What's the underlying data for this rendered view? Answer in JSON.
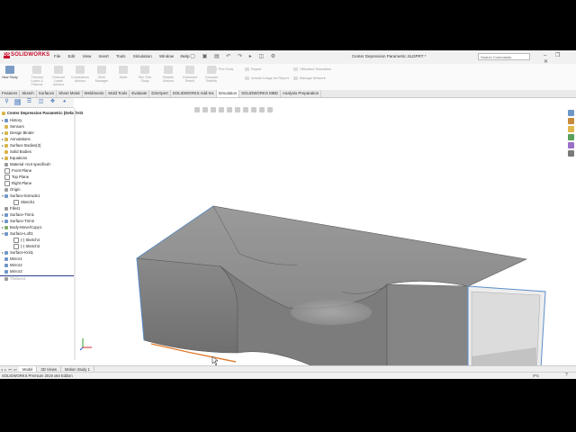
{
  "app": {
    "logo": "SOLIDWORKS",
    "logo_badge": "DS",
    "menu": [
      "File",
      "Edit",
      "View",
      "Insert",
      "Tools",
      "Simulation",
      "Window",
      "Help"
    ],
    "document_title": "Center Depression Parametric.SLDPRT *",
    "search_placeholder": "Search Commands",
    "quick_access": "⌂ ▢ ▣ ▤ ↶ ↷ ▸ ◫ ⚙",
    "window_controls": "– ❐ ✕"
  },
  "ribbon": {
    "new_study": "New Study",
    "buttons": [
      "Thermal Loads & Fixtures",
      "External Loads Advisor",
      "Connections Advisor",
      "Shell Manager",
      "Mesh",
      "Run This Study",
      "Results Advisor",
      "Deformed Result",
      "Compare Results"
    ],
    "small_buttons": [
      "Plot Tools",
      "Report",
      "Include Image for Report",
      "Offloaded Simulation",
      "Manage Network"
    ]
  },
  "command_tabs": [
    "Features",
    "Sketch",
    "Surfaces",
    "Sheet Metal",
    "Weldments",
    "Mold Tools",
    "Evaluate",
    "DimXpert",
    "SOLIDWORKS Add-Ins",
    "Simulation",
    "SOLIDWORKS MBD",
    "Analysis Preparation"
  ],
  "active_command_tab": "Simulation",
  "feature_tree": {
    "root": "Center Depression Parametric  (Default<D",
    "items": [
      {
        "label": "History",
        "icon": "history-icon",
        "exp": "▸"
      },
      {
        "label": "Sensors",
        "icon": "sensors-icon",
        "exp": ""
      },
      {
        "label": "Design Binder",
        "icon": "design-binder-icon",
        "exp": "▸"
      },
      {
        "label": "Annotations",
        "icon": "annotations-icon",
        "exp": "▸"
      },
      {
        "label": "Surface Bodies(3)",
        "icon": "surface-bodies-icon",
        "exp": "▸"
      },
      {
        "label": "Solid Bodies",
        "icon": "solid-bodies-icon",
        "exp": ""
      },
      {
        "label": "Equations",
        "icon": "equations-icon",
        "exp": "▸"
      },
      {
        "label": "Material <not specified>",
        "icon": "material-icon",
        "exp": ""
      },
      {
        "label": "Front Plane",
        "icon": "plane-icon",
        "exp": ""
      },
      {
        "label": "Top Plane",
        "icon": "plane-icon",
        "exp": ""
      },
      {
        "label": "Right Plane",
        "icon": "plane-icon",
        "exp": ""
      },
      {
        "label": "Origin",
        "icon": "origin-icon",
        "exp": ""
      },
      {
        "label": "Surface-Extrude1",
        "icon": "surface-extrude-icon",
        "exp": "▾"
      },
      {
        "label": "Sketch1",
        "icon": "sketch-icon",
        "exp": "",
        "indent": 1
      },
      {
        "label": "Fillet1",
        "icon": "fillet-icon",
        "exp": ""
      },
      {
        "label": "Surface-Trim1",
        "icon": "surface-trim-icon",
        "exp": "▸"
      },
      {
        "label": "Surface-Trim2",
        "icon": "surface-trim-icon",
        "exp": "▸"
      },
      {
        "label": "Body-Move/Copy1",
        "icon": "move-copy-icon",
        "exp": "▸"
      },
      {
        "label": "Surface-Loft1",
        "icon": "surface-loft-icon",
        "exp": "▾"
      },
      {
        "label": "(-) Sketch4",
        "icon": "sketch-icon",
        "exp": "",
        "indent": 1
      },
      {
        "label": "(-) Sketch3",
        "icon": "sketch-icon",
        "exp": "",
        "indent": 1
      },
      {
        "label": "Surface-Knit1",
        "icon": "surface-knit-icon",
        "exp": "▸"
      },
      {
        "label": "Mirror1",
        "icon": "mirror-icon",
        "exp": ""
      },
      {
        "label": "Mirror2",
        "icon": "mirror-icon",
        "exp": ""
      },
      {
        "label": "Mirror3",
        "icon": "mirror-icon",
        "exp": ""
      },
      {
        "label": "Thicken1",
        "icon": "thicken-icon",
        "exp": "",
        "grayed": true
      }
    ]
  },
  "bottom_tabs": [
    "Model",
    "3D Views",
    "Motion Study 1"
  ],
  "active_bottom_tab": "Model",
  "status": {
    "message": "SOLIDWORKS Premium 2019 x64 Edition",
    "units": "IPS"
  },
  "colors": {
    "ribbon_bg": "#fafafa",
    "accent": "#3a6fb0",
    "model_gray": "#8e8e8e",
    "edge_highlight": "#5b8fc9",
    "selected_edge": "#e07a2c"
  }
}
